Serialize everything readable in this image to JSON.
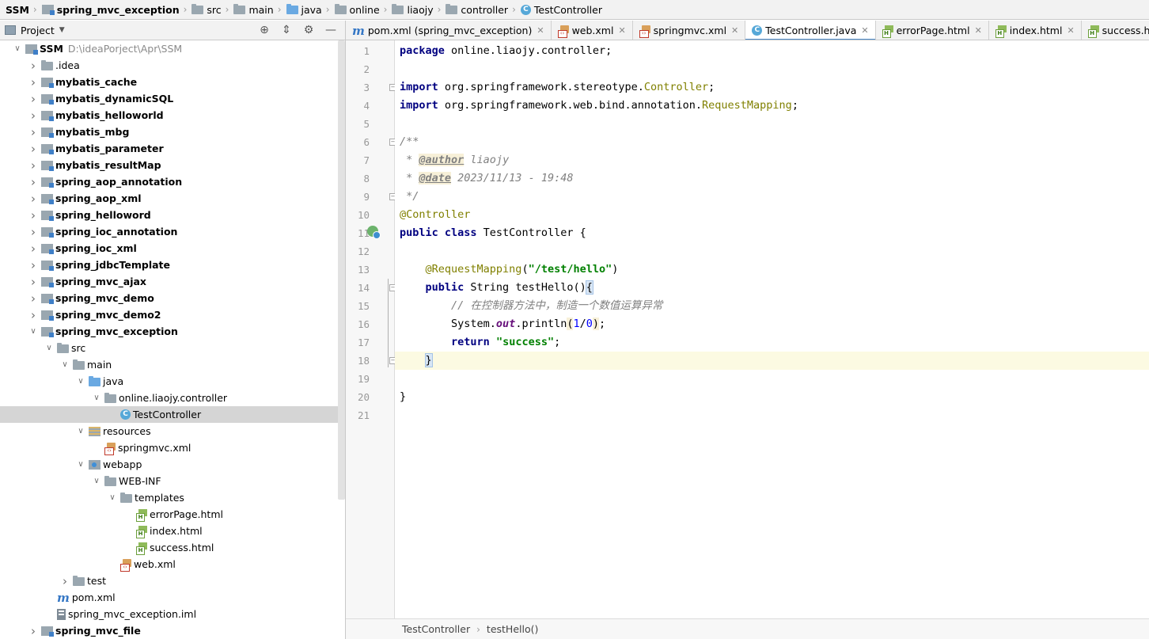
{
  "breadcrumb": [
    "SSM",
    "spring_mvc_exception",
    "src",
    "main",
    "java",
    "online",
    "liaojy",
    "controller",
    "TestController"
  ],
  "project_panel": {
    "title": "Project"
  },
  "tree": [
    {
      "label": "SSM",
      "path": "D:\\ideaPorject\\Apr\\SSM",
      "depth": 0,
      "expanded": true,
      "bold": true,
      "icon": "module-folder"
    },
    {
      "label": ".idea",
      "depth": 1,
      "expanded": false,
      "bold": false,
      "icon": "folder"
    },
    {
      "label": "mybatis_cache",
      "depth": 1,
      "expanded": false,
      "bold": true,
      "icon": "module-folder"
    },
    {
      "label": "mybatis_dynamicSQL",
      "depth": 1,
      "expanded": false,
      "bold": true,
      "icon": "module-folder"
    },
    {
      "label": "mybatis_helloworld",
      "depth": 1,
      "expanded": false,
      "bold": true,
      "icon": "module-folder"
    },
    {
      "label": "mybatis_mbg",
      "depth": 1,
      "expanded": false,
      "bold": true,
      "icon": "module-folder"
    },
    {
      "label": "mybatis_parameter",
      "depth": 1,
      "expanded": false,
      "bold": true,
      "icon": "module-folder"
    },
    {
      "label": "mybatis_resultMap",
      "depth": 1,
      "expanded": false,
      "bold": true,
      "icon": "module-folder"
    },
    {
      "label": "spring_aop_annotation",
      "depth": 1,
      "expanded": false,
      "bold": true,
      "icon": "module-folder"
    },
    {
      "label": "spring_aop_xml",
      "depth": 1,
      "expanded": false,
      "bold": true,
      "icon": "module-folder"
    },
    {
      "label": "spring_helloword",
      "depth": 1,
      "expanded": false,
      "bold": true,
      "icon": "module-folder"
    },
    {
      "label": "spring_ioc_annotation",
      "depth": 1,
      "expanded": false,
      "bold": true,
      "icon": "module-folder"
    },
    {
      "label": "spring_ioc_xml",
      "depth": 1,
      "expanded": false,
      "bold": true,
      "icon": "module-folder"
    },
    {
      "label": "spring_jdbcTemplate",
      "depth": 1,
      "expanded": false,
      "bold": true,
      "icon": "module-folder"
    },
    {
      "label": "spring_mvc_ajax",
      "depth": 1,
      "expanded": false,
      "bold": true,
      "icon": "module-folder"
    },
    {
      "label": "spring_mvc_demo",
      "depth": 1,
      "expanded": false,
      "bold": true,
      "icon": "module-folder"
    },
    {
      "label": "spring_mvc_demo2",
      "depth": 1,
      "expanded": false,
      "bold": true,
      "icon": "module-folder"
    },
    {
      "label": "spring_mvc_exception",
      "depth": 1,
      "expanded": true,
      "bold": true,
      "icon": "module-folder"
    },
    {
      "label": "src",
      "depth": 2,
      "expanded": true,
      "bold": false,
      "icon": "folder"
    },
    {
      "label": "main",
      "depth": 3,
      "expanded": true,
      "bold": false,
      "icon": "folder"
    },
    {
      "label": "java",
      "depth": 4,
      "expanded": true,
      "bold": false,
      "icon": "source-folder"
    },
    {
      "label": "online.liaojy.controller",
      "depth": 5,
      "expanded": true,
      "bold": false,
      "icon": "package"
    },
    {
      "label": "TestController",
      "depth": 6,
      "expanded": null,
      "bold": false,
      "icon": "class",
      "selected": true
    },
    {
      "label": "resources",
      "depth": 4,
      "expanded": true,
      "bold": false,
      "icon": "resources-folder"
    },
    {
      "label": "springmvc.xml",
      "depth": 5,
      "expanded": null,
      "bold": false,
      "icon": "xml"
    },
    {
      "label": "webapp",
      "depth": 4,
      "expanded": true,
      "bold": false,
      "icon": "webapp-folder"
    },
    {
      "label": "WEB-INF",
      "depth": 5,
      "expanded": true,
      "bold": false,
      "icon": "folder"
    },
    {
      "label": "templates",
      "depth": 6,
      "expanded": true,
      "bold": false,
      "icon": "folder"
    },
    {
      "label": "errorPage.html",
      "depth": 7,
      "expanded": null,
      "bold": false,
      "icon": "html"
    },
    {
      "label": "index.html",
      "depth": 7,
      "expanded": null,
      "bold": false,
      "icon": "html"
    },
    {
      "label": "success.html",
      "depth": 7,
      "expanded": null,
      "bold": false,
      "icon": "html"
    },
    {
      "label": "web.xml",
      "depth": 6,
      "expanded": null,
      "bold": false,
      "icon": "xml"
    },
    {
      "label": "test",
      "depth": 3,
      "expanded": false,
      "bold": false,
      "icon": "folder"
    },
    {
      "label": "pom.xml",
      "depth": 2,
      "expanded": null,
      "bold": false,
      "icon": "maven"
    },
    {
      "label": "spring_mvc_exception.iml",
      "depth": 2,
      "expanded": null,
      "bold": false,
      "icon": "iml"
    },
    {
      "label": "spring_mvc_file",
      "depth": 1,
      "expanded": false,
      "bold": true,
      "icon": "module-folder"
    }
  ],
  "tabs": [
    {
      "label": "pom.xml (spring_mvc_exception)",
      "icon": "maven",
      "active": false
    },
    {
      "label": "web.xml",
      "icon": "xml",
      "active": false
    },
    {
      "label": "springmvc.xml",
      "icon": "xml",
      "active": false
    },
    {
      "label": "TestController.java",
      "icon": "class",
      "active": true
    },
    {
      "label": "errorPage.html",
      "icon": "html",
      "active": false
    },
    {
      "label": "index.html",
      "icon": "html",
      "active": false
    },
    {
      "label": "success.html",
      "icon": "html",
      "active": false
    }
  ],
  "editor": {
    "current_line": 18,
    "lines": [
      [
        {
          "t": "package ",
          "c": "kw"
        },
        {
          "t": "online.liaojy.controller;"
        }
      ],
      [],
      [
        {
          "t": "import ",
          "c": "kw"
        },
        {
          "t": "org.springframework.stereotype."
        },
        {
          "t": "Controller",
          "c": "an"
        },
        {
          "t": ";"
        }
      ],
      [
        {
          "t": "import ",
          "c": "kw"
        },
        {
          "t": "org.springframework.web.bind.annotation."
        },
        {
          "t": "RequestMapping",
          "c": "an"
        },
        {
          "t": ";"
        }
      ],
      [],
      [
        {
          "t": "/**",
          "c": "cm"
        }
      ],
      [
        {
          "t": " * ",
          "c": "cm"
        },
        {
          "t": "@author",
          "c": "tag"
        },
        {
          "t": " liaojy",
          "c": "cm"
        }
      ],
      [
        {
          "t": " * ",
          "c": "cm"
        },
        {
          "t": "@date",
          "c": "tag"
        },
        {
          "t": " 2023/11/13 - 19:48",
          "c": "cm"
        }
      ],
      [
        {
          "t": " */",
          "c": "cm"
        }
      ],
      [
        {
          "t": "@Controller",
          "c": "an"
        }
      ],
      [
        {
          "t": "public class ",
          "c": "kw"
        },
        {
          "t": "TestController {"
        }
      ],
      [],
      [
        {
          "t": "    "
        },
        {
          "t": "@RequestMapping",
          "c": "an"
        },
        {
          "t": "("
        },
        {
          "t": "\"/test/hello\"",
          "c": "str"
        },
        {
          "t": ")"
        }
      ],
      [
        {
          "t": "    "
        },
        {
          "t": "public ",
          "c": "kw"
        },
        {
          "t": "String testHello()"
        },
        {
          "t": "{",
          "c": "brh"
        }
      ],
      [
        {
          "t": "        "
        },
        {
          "t": "// 在控制器方法中，制造一个数值运算异常",
          "c": "cm"
        }
      ],
      [
        {
          "t": "        System."
        },
        {
          "t": "out",
          "c": "fld"
        },
        {
          "t": ".println"
        },
        {
          "t": "(",
          "c": "hl"
        },
        {
          "t": "1",
          "c": "num"
        },
        {
          "t": "/"
        },
        {
          "t": "0",
          "c": "num"
        },
        {
          "t": ")",
          "c": "hl"
        },
        {
          "t": ";"
        }
      ],
      [
        {
          "t": "        "
        },
        {
          "t": "return ",
          "c": "kw"
        },
        {
          "t": "\"success\"",
          "c": "str"
        },
        {
          "t": ";"
        }
      ],
      [
        {
          "t": "    "
        },
        {
          "t": "}",
          "c": "brh"
        }
      ],
      [],
      [
        {
          "t": "}"
        }
      ],
      []
    ]
  },
  "status_breadcrumb": [
    "TestController",
    "testHello()"
  ]
}
